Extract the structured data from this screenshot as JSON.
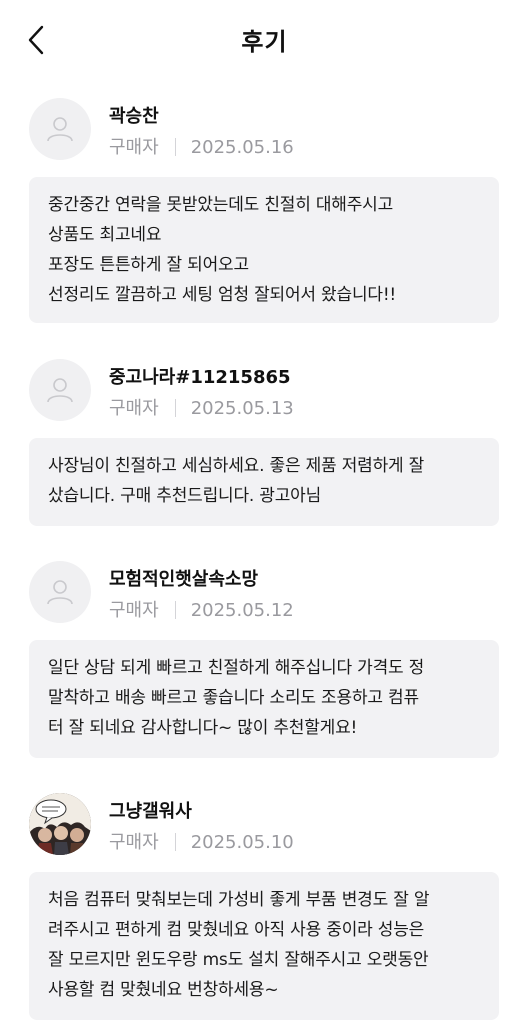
{
  "header": {
    "title": "후기"
  },
  "icons": {
    "back": "chevron-left-icon",
    "default_avatar": "user-icon"
  },
  "reviews": [
    {
      "name": "곽승찬",
      "role": "구매자",
      "date": "2025.05.16",
      "lines": [
        "중간중간 연락을 못받았는데도 친절히 대해주시고",
        "상품도 최고네요",
        "포장도 튼튼하게 잘 되어오고",
        "선정리도 깔끔하고 세팅 엄청 잘되어서 왔습니다!!"
      ]
    },
    {
      "name": "중고나라#11215865",
      "role": "구매자",
      "date": "2025.05.13",
      "lines": [
        "사장님이 친절하고 세심하세요.  좋은 제품 저렴하게 잘",
        "샀습니다. 구매 추천드립니다. 광고아님"
      ]
    },
    {
      "name": "모험적인햇살속소망",
      "role": "구매자",
      "date": "2025.05.12",
      "lines": [
        "일단 상담 되게 빠르고 친절하게 해주십니다 가격도 정",
        "말착하고 배송 빠르고 좋습니다 소리도 조용하고 컴퓨",
        "터 잘 되네요 감사합니다~ 많이 추천할게요!"
      ]
    },
    {
      "name": "그냥갤워사",
      "role": "구매자",
      "date": "2025.05.10",
      "lines": [
        "처음 컴퓨터 맞춰보는데 가성비 좋게 부품 변경도 잘 알",
        "려주시고 편하게 컴 맞췄네요 아직 사용 중이라 성능은",
        "잘 모르지만 윈도우랑 ms도 설치 잘해주시고 오랫동안",
        "사용할 컴 맞췄네요 번창하세용~"
      ]
    }
  ]
}
